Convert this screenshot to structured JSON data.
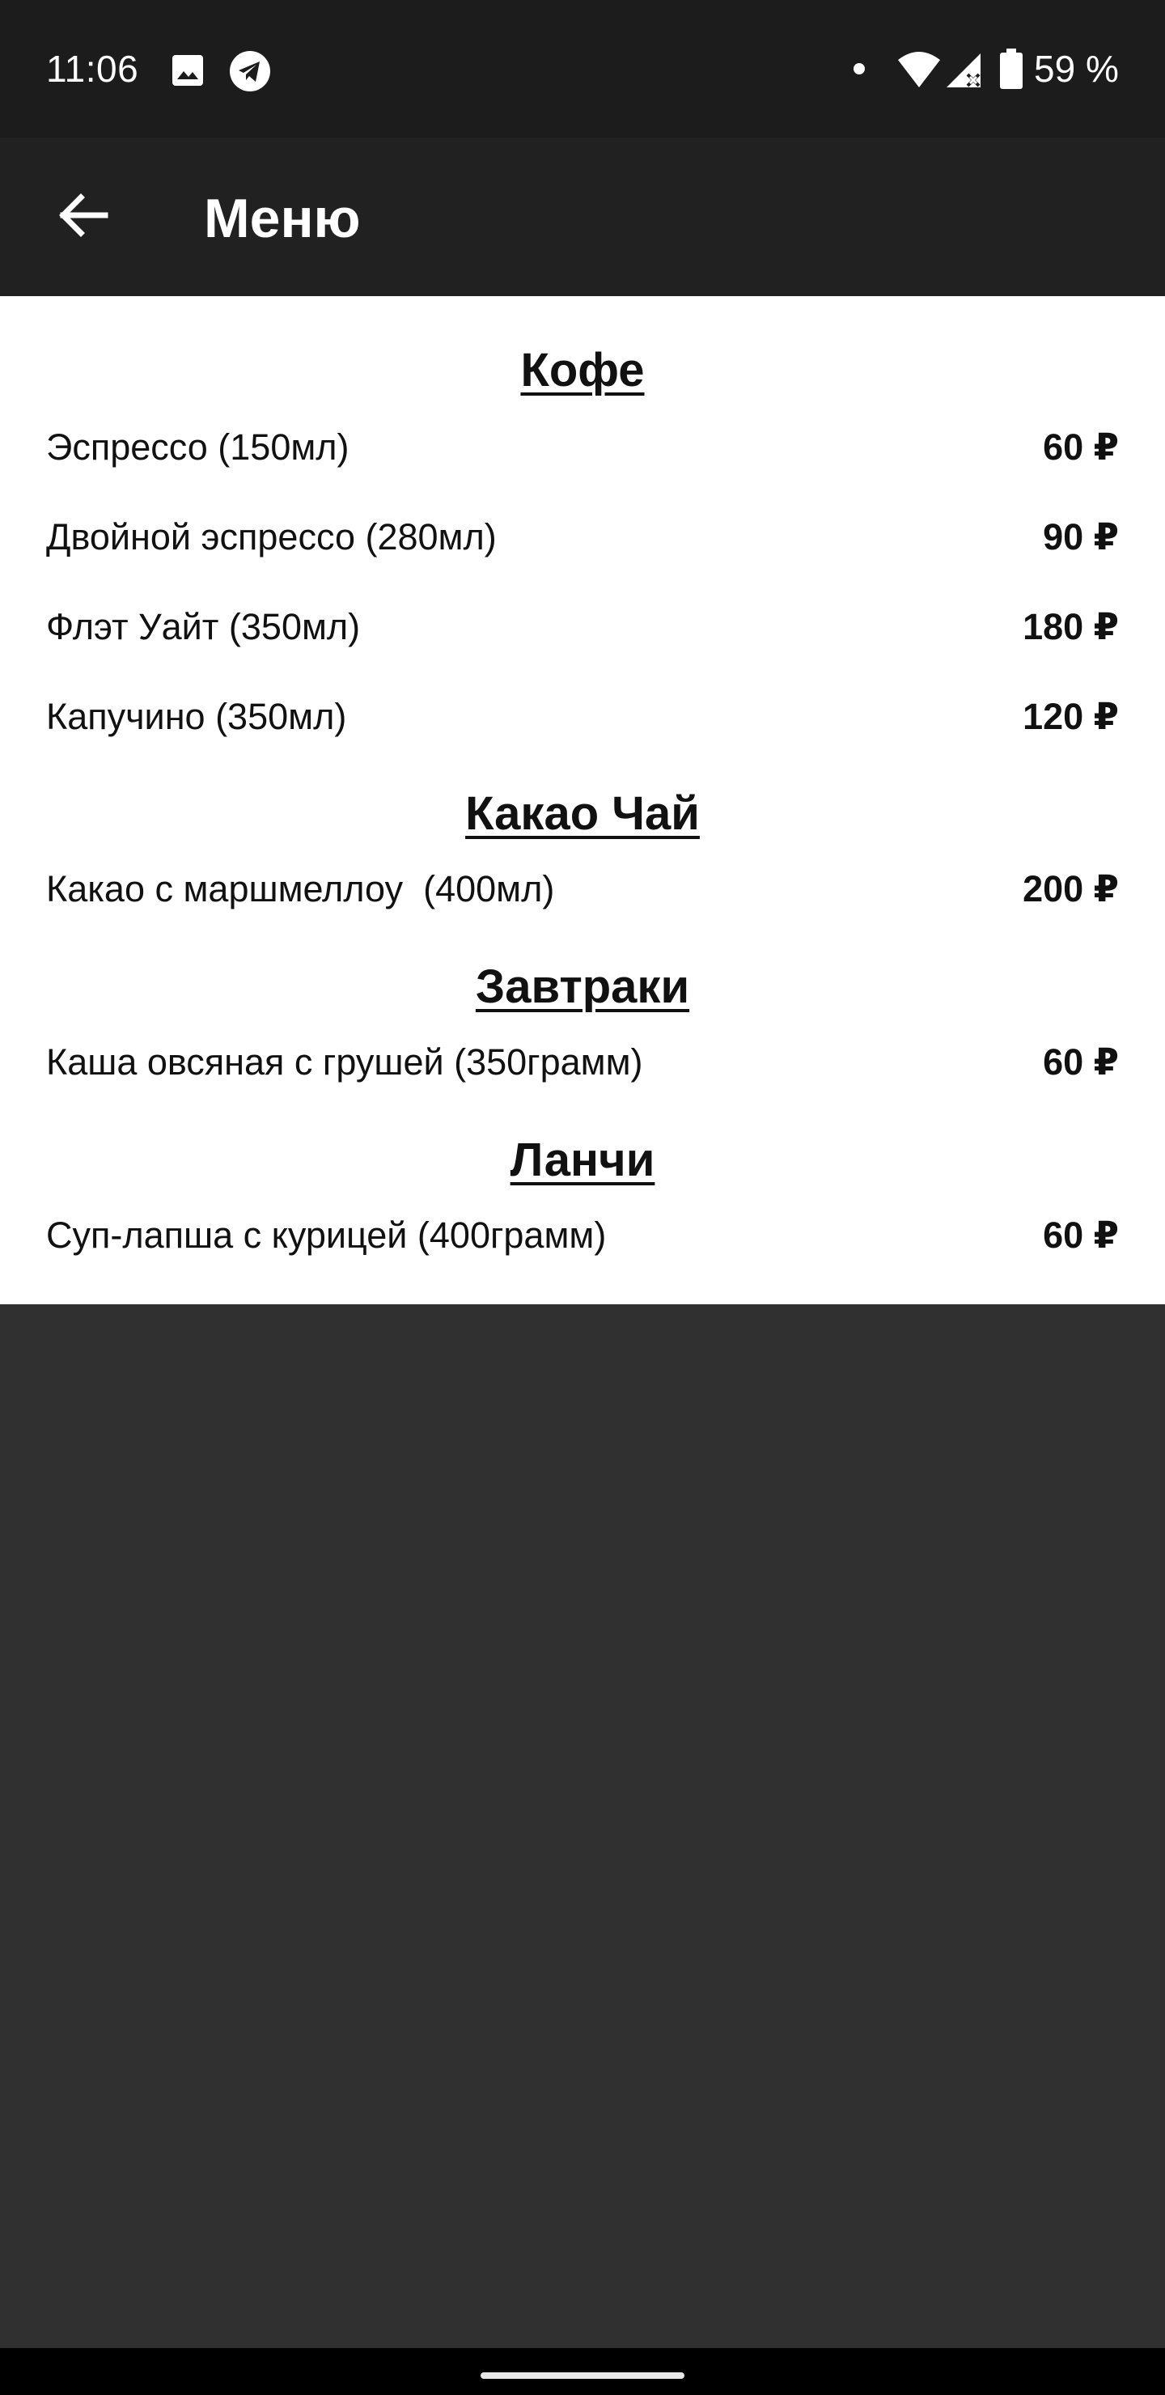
{
  "status_bar": {
    "time": "11:06",
    "battery_percent": "59 %",
    "icons": [
      "image-icon",
      "telegram-icon",
      "dot-icon",
      "wifi-icon",
      "signal-icon",
      "battery-icon"
    ]
  },
  "app_bar": {
    "title": "Меню",
    "back_icon": "arrow-left-icon"
  },
  "menu": {
    "sections": [
      {
        "title": "Кофе",
        "items": [
          {
            "name": "Эспрессо (150мл)",
            "price": "60 ₽"
          },
          {
            "name": "Двойной эспрессо (280мл)",
            "price": "90 ₽"
          },
          {
            "name": "Флэт Уайт (350мл)",
            "price": "180 ₽"
          },
          {
            "name": "Капучино (350мл)",
            "price": "120 ₽"
          }
        ]
      },
      {
        "title": "Какао Чай",
        "items": [
          {
            "name": "Какао с маршмеллоу  (400мл)",
            "price": "200 ₽"
          }
        ]
      },
      {
        "title": "Завтраки",
        "items": [
          {
            "name": "Каша овсяная с грушей (350грамм)",
            "price": "60 ₽"
          }
        ]
      },
      {
        "title": "Ланчи",
        "items": [
          {
            "name": "Суп-лапша с курицей (400грамм)",
            "price": "60 ₽"
          }
        ]
      }
    ]
  },
  "colors": {
    "status_bar_bg": "#1c1c1c",
    "app_bar_bg": "#212121",
    "content_bg": "#ffffff",
    "page_bg": "#303030"
  }
}
